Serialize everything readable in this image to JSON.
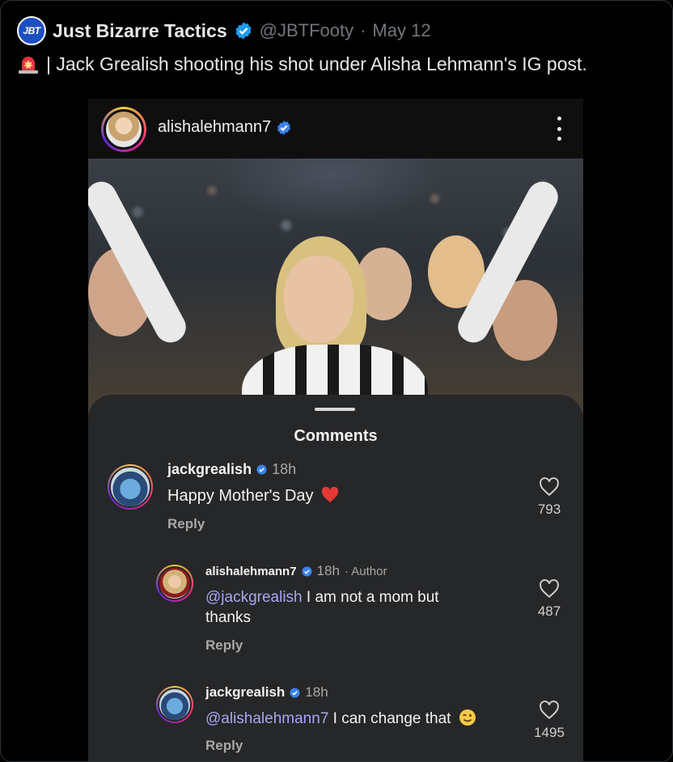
{
  "tweet": {
    "avatar_text": "JBT",
    "display_name": "Just Bizarre Tactics",
    "handle": "@JBTFooty",
    "separator": "·",
    "date": "May 12",
    "text": "| Jack Grealish shooting his shot under Alisha Lehmann's IG post.",
    "emoji": "siren",
    "colors": {
      "background": "#000000",
      "text": "#e7e9ea",
      "muted": "#71767b",
      "verified": "#1d9bf0"
    }
  },
  "instagram": {
    "post_username": "alishalehmann7",
    "sheet_title": "Comments",
    "comments": [
      {
        "username": "jackgrealish",
        "time": "18h",
        "author_tag": "",
        "mention": "",
        "text": "Happy Mother's Day",
        "emoji": "heart",
        "reply_label": "Reply",
        "likes": "793"
      },
      {
        "username": "alishalehmann7",
        "time": "18h",
        "author_tag": "· Author",
        "mention": "@jackgrealish",
        "text": " I am not a mom but",
        "text_line2": "thanks",
        "reply_label": "Reply",
        "likes": "487"
      },
      {
        "username": "jackgrealish",
        "time": "18h",
        "author_tag": "",
        "mention": "@alishalehmann7",
        "text": " I can change that",
        "emoji": "wink",
        "reply_label": "Reply",
        "likes": "1495"
      }
    ],
    "colors": {
      "sheet": "#262729",
      "mention": "#a9a6f4",
      "verified": "#3b82f6"
    }
  }
}
